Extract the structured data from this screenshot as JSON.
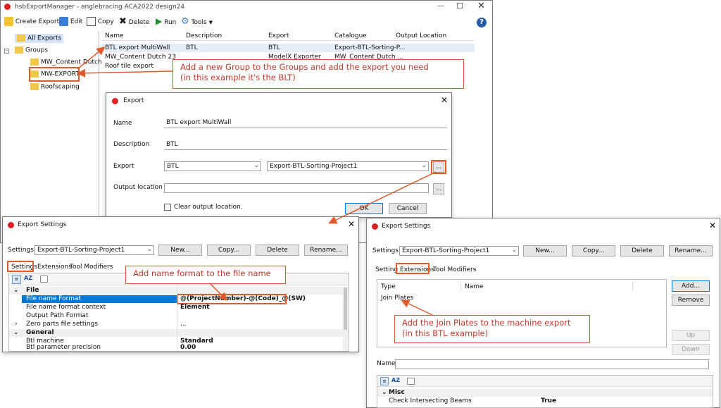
{
  "main": {
    "title": "hsbExportManager - anglebracing ACA2022 design24",
    "toolbar": {
      "create": "Create Export",
      "edit": "Edit",
      "copy": "Copy",
      "delete": "Delete",
      "run": "Run",
      "tools": "Tools"
    },
    "tree": {
      "all": "All Exports",
      "groups": "Groups",
      "items": [
        "MW_Content Dutch",
        "MW-EXPORT",
        "Roofscaping"
      ]
    },
    "columns": [
      "Name",
      "Description",
      "Export",
      "Catalogue",
      "Output Location"
    ],
    "rows": [
      [
        "BTL export MultiWall",
        "BTL",
        "BTL",
        "Export-BTL-Sorting-P..."
      ],
      [
        "MW_Content Dutch 23",
        "",
        "ModelX Exporter",
        "MW_Content Dutch ..."
      ],
      [
        "Roof tile export",
        "",
        "",
        ""
      ]
    ]
  },
  "export_dialog": {
    "title": "Export",
    "name_label": "Name",
    "name_value": "BTL export MultiWall",
    "desc_label": "Description",
    "desc_value": "BTL",
    "export_label": "Export",
    "export_value": "BTL",
    "catalogue_value": "Export-BTL-Sorting-Project1",
    "output_label": "Output location",
    "output_value": "",
    "clear_label": "Clear output location.",
    "browse": "...",
    "ok": "OK",
    "cancel": "Cancel"
  },
  "settings_left": {
    "title": "Export Settings",
    "settings_label": "Settings",
    "settings_value": "Export-BTL-Sorting-Project1",
    "new": "New...",
    "copy": "Copy...",
    "delete": "Delete",
    "rename": "Rename...",
    "tabs": [
      "Settings",
      "Extensions",
      "Tool Modifiers"
    ],
    "cat_file": "File",
    "props": [
      [
        "File name Format",
        "@(ProjectNumber)-@(Code)_@(SW)"
      ],
      [
        "File name format context",
        "Element"
      ],
      [
        "Output Path Format",
        ""
      ],
      [
        "Zero parts file settings",
        "..."
      ]
    ],
    "cat_general": "General",
    "props2": [
      [
        "Btl machine",
        "Standard"
      ],
      [
        "Btl parameter precision",
        "0.00"
      ]
    ]
  },
  "settings_right": {
    "title": "Export Settings",
    "settings_label": "Settings",
    "settings_value": "Export-BTL-Sorting-Project1",
    "new": "New...",
    "copy": "Copy...",
    "delete": "Delete",
    "rename": "Rename...",
    "tabs": [
      "Settings",
      "Extensions",
      "Tool Modifiers"
    ],
    "ext_cols": [
      "Type",
      "Name"
    ],
    "ext_item": "Join Plates",
    "add": "Add...",
    "remove": "Remove",
    "up": "Up",
    "down": "Down",
    "name_label": "Name",
    "cat_misc": "Misc",
    "misc_prop": [
      "Check Intersecting Beams",
      "True"
    ]
  },
  "callouts": {
    "groups": [
      "Add a new Group to the Groups and add the export you need",
      "(in this example it's the BLT)"
    ],
    "name_format": "Add name format to the file name",
    "join_plates": [
      "Add the Join Plates to the machine export",
      "(in this BTL example)"
    ]
  },
  "colors": {
    "accent": "#e05a2b",
    "callout_text": "#c0392b",
    "selection": "#0078d7"
  }
}
